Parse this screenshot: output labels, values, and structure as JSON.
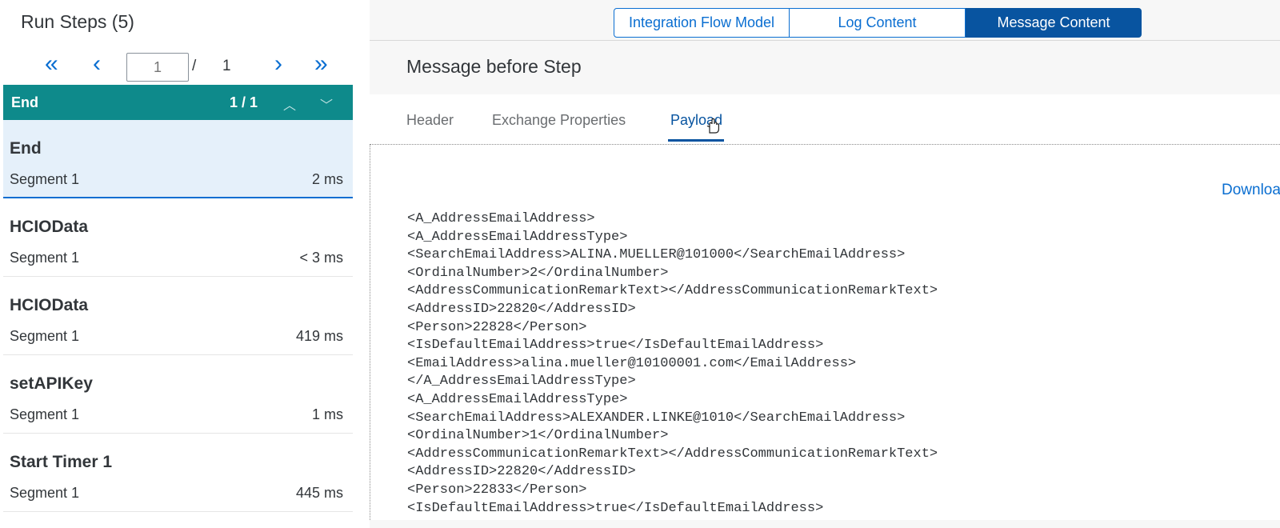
{
  "left_panel": {
    "title": "Run Steps (5)",
    "pager": {
      "first_icon": "«",
      "prev_icon": "‹",
      "next_icon": "›",
      "last_icon": "»",
      "page_placeholder": "1",
      "separator": "/",
      "total": "1"
    },
    "group": {
      "title": "End",
      "count": "1 / 1",
      "up_icon": "︿",
      "down_icon": "﹀"
    },
    "steps": [
      {
        "name": "End",
        "segment": "Segment 1",
        "time": "2 ms",
        "selected": true
      },
      {
        "name": "HCIOData",
        "segment": "Segment 1",
        "time": "< 3 ms"
      },
      {
        "name": "HCIOData",
        "segment": "Segment 1",
        "time": "419 ms"
      },
      {
        "name": "setAPIKey",
        "segment": "Segment 1",
        "time": "1 ms"
      },
      {
        "name": "Start Timer 1",
        "segment": "Segment 1",
        "time": "445 ms"
      }
    ]
  },
  "right_panel": {
    "segments": {
      "integration_flow_model": "Integration Flow Model",
      "log_content": "Log Content",
      "message_content": "Message Content"
    },
    "message_title": "Message before Step",
    "tabs": {
      "header": "Header",
      "exchange_properties": "Exchange Properties",
      "payload": "Payload"
    },
    "download_label": "Download",
    "payload_lines": [
      "<A_AddressEmailAddress>",
      "<A_AddressEmailAddressType>",
      "<SearchEmailAddress>ALINA.MUELLER@101000</SearchEmailAddress>",
      "<OrdinalNumber>2</OrdinalNumber>",
      "<AddressCommunicationRemarkText></AddressCommunicationRemarkText>",
      "<AddressID>22820</AddressID>",
      "<Person>22828</Person>",
      "<IsDefaultEmailAddress>true</IsDefaultEmailAddress>",
      "<EmailAddress>alina.mueller@10100001.com</EmailAddress>",
      "</A_AddressEmailAddressType>",
      "<A_AddressEmailAddressType>",
      "<SearchEmailAddress>ALEXANDER.LINKE@1010</SearchEmailAddress>",
      "<OrdinalNumber>1</OrdinalNumber>",
      "<AddressCommunicationRemarkText></AddressCommunicationRemarkText>",
      "<AddressID>22820</AddressID>",
      "<Person>22833</Person>",
      "<IsDefaultEmailAddress>true</IsDefaultEmailAddress>"
    ]
  },
  "colors": {
    "accent": "#0a6ed1",
    "accent_dark": "#0854a0",
    "group_bar": "#0e8a8b",
    "selected_row": "#e5f0fa"
  }
}
